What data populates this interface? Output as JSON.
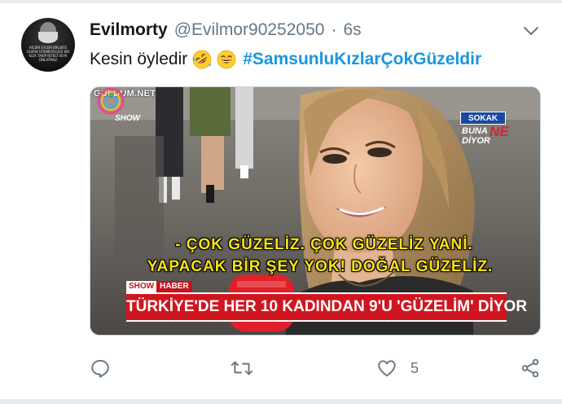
{
  "user": {
    "display_name": "Evilmorty",
    "handle": "@Evilmor90252050",
    "separator": "·",
    "time": "6s",
    "avatar_quote": "HİÇBİR EYLEM BİRLİKTE OLMAK İSTEMEYECEĞİ BİR KIZA TAKIP İSTECİ VEYA ONLATMAZ"
  },
  "tweet": {
    "text": "Kesin öyledir",
    "emojis": [
      "rolling-on-floor-laughing-emoji",
      "grinning-squinting-emoji"
    ],
    "hashtag": "#SamsunluKızlarÇokGüzeldir"
  },
  "media": {
    "watermark": "GULDUM.NET",
    "channel_logo": "SHOW",
    "program_badge": "SOKAK",
    "program_title_1": "BUNA",
    "program_title_ne": "NE",
    "program_title_2": "DİYOR",
    "subtitle_line_1": "- ÇOK GÜZELİZ. ÇOK GÜZELİZ YANİ.",
    "subtitle_line_2": "YAPACAK BİR ŞEY YOK! DOĞAL GÜZELİZ.",
    "lower_tag_show": "SHOW",
    "lower_tag_haber": "HABER",
    "ticker": "TÜRKİYE'DE HER 10 KADINDAN 9'U 'GÜZELİM' DİYOR"
  },
  "actions": {
    "reply_icon": "reply-icon",
    "retweet_icon": "retweet-icon",
    "like_icon": "heart-icon",
    "like_count": "5",
    "share_icon": "share-icon"
  },
  "colors": {
    "accent": "#1b95e0",
    "secondary_text": "#657786",
    "primary_text": "#14171a",
    "ticker_red": "#cf1620",
    "subtitle_yellow": "#f6e21b"
  }
}
